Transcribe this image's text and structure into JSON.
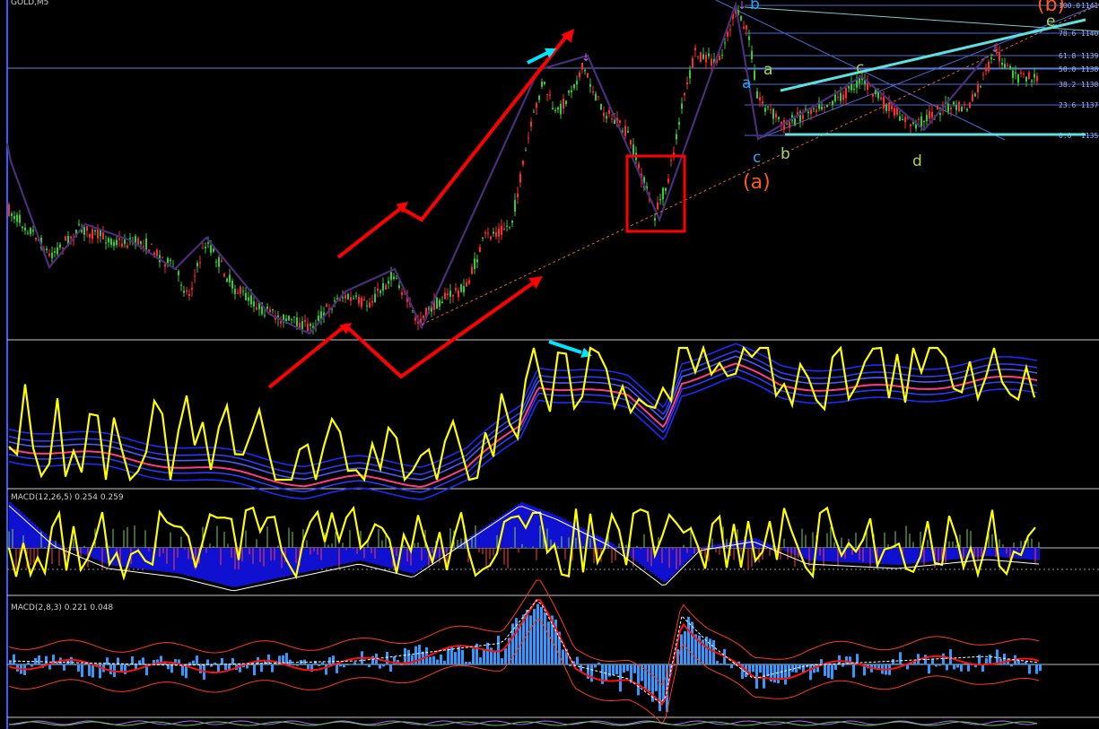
{
  "symbol_title": "GOLD,M5",
  "indicators": {
    "macd1": "MACD(12,26,5) 0.254 0.259",
    "macd2": "MACD(2,8,3) 0.221 0.048"
  },
  "fib_levels": [
    {
      "pct": "100.0",
      "price": "1141"
    },
    {
      "pct": "78.6",
      "price": "1140"
    },
    {
      "pct": "61.8",
      "price": "1139"
    },
    {
      "pct": "50.0",
      "price": "1138"
    },
    {
      "pct": "38.2",
      "price": "1138"
    },
    {
      "pct": "23.6",
      "price": "1137"
    },
    {
      "pct": "0.0",
      "price": "1135"
    }
  ],
  "wave_labels": {
    "blue_b": "b",
    "blue_a": "a",
    "blue_c": "c",
    "green_a": "a",
    "green_b": "b",
    "green_c": "c",
    "green_d": "d",
    "green_e": "e",
    "paren_a": "(a)",
    "paren_b": "(b)"
  },
  "colors": {
    "background": "#000000",
    "bull_candle": "#32cd32",
    "bear_candle": "#ff2a2a",
    "zigzag": "#4b2d7a",
    "annotation_red": "#ff0000",
    "annotation_cyan": "#00e5ff",
    "trendline_cyan": "#5fe0e0",
    "fib_line": "#4a6bd6",
    "oscillator_yellow": "#ffff00",
    "band_blue": "#1a2bff",
    "macd_histogram_blue": "#1010d0",
    "macd2_histogram": "#3399ff",
    "wave_blue": "#1fa7ff",
    "wave_green": "#a8d64a",
    "wave_orange": "#ff5a1a"
  }
}
